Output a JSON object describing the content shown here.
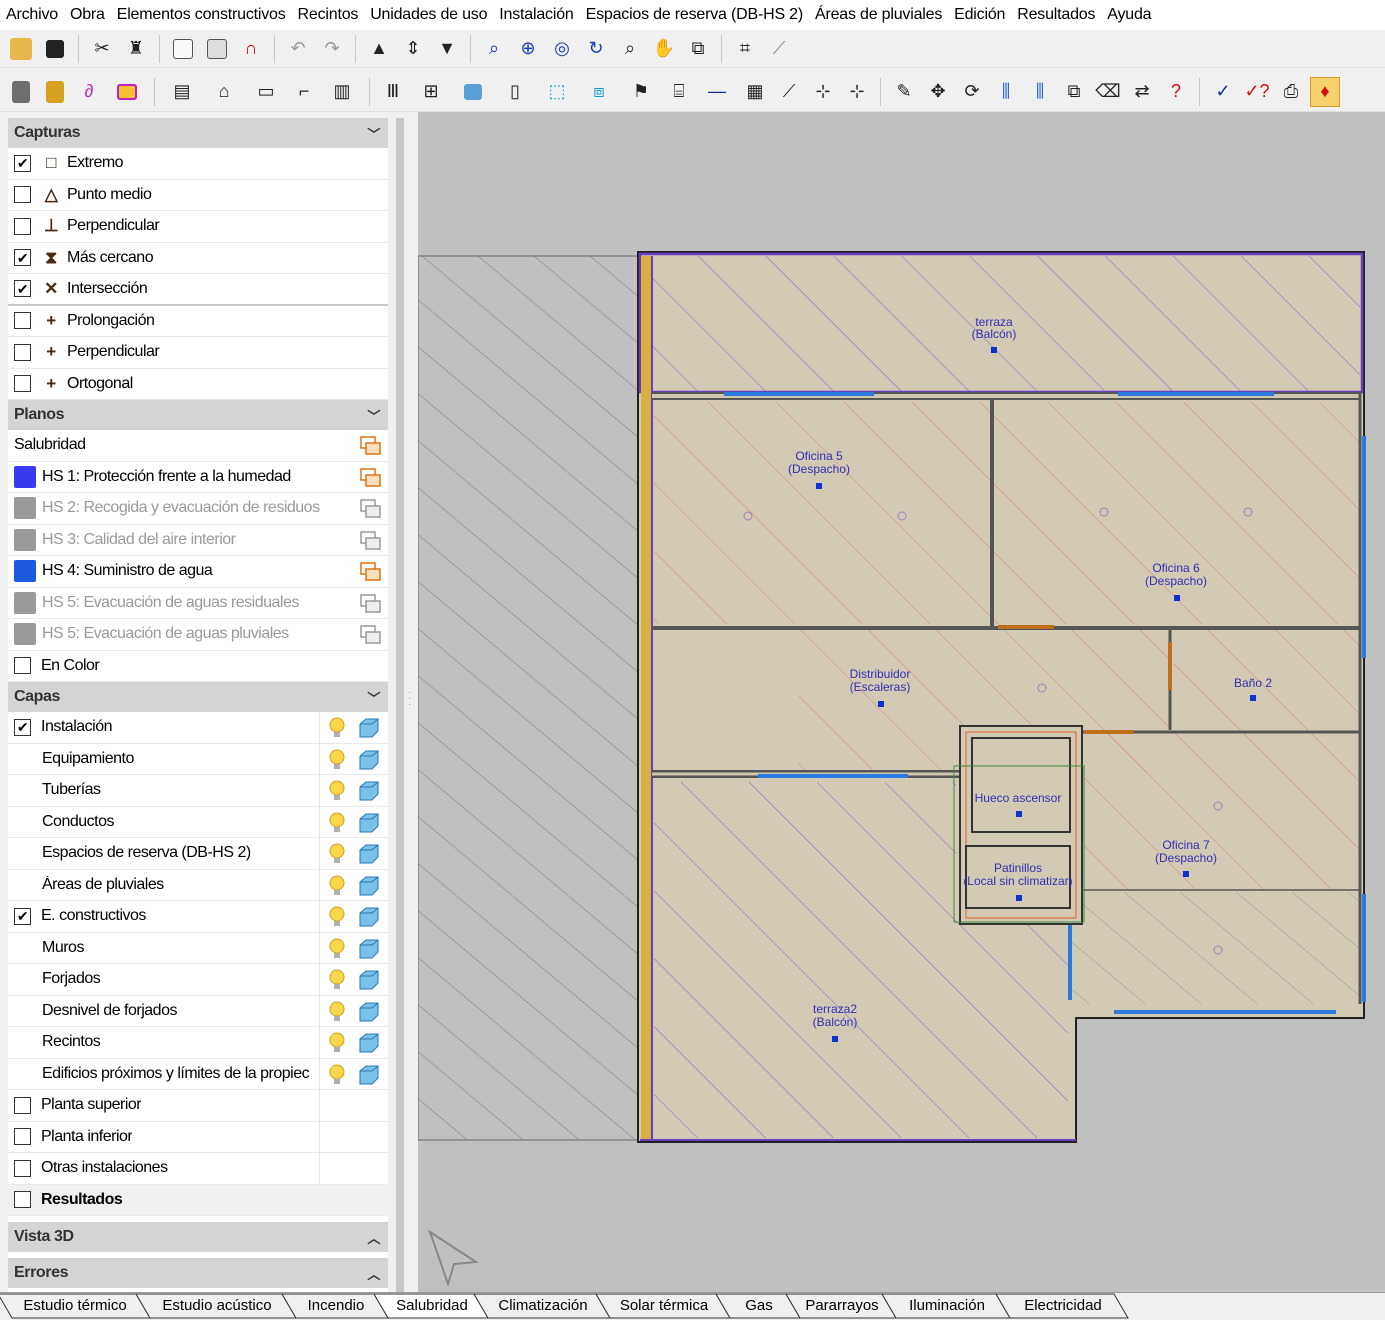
{
  "menu": [
    "Archivo",
    "Obra",
    "Elementos constructivos",
    "Recintos",
    "Unidades de uso",
    "Instalación",
    "Espacios de reserva (DB-HS 2)",
    "Áreas de pluviales",
    "Edición",
    "Resultados",
    "Ayuda"
  ],
  "capturas": {
    "title": "Capturas",
    "items": [
      {
        "label": "Extremo",
        "checked": true,
        "icon": "□"
      },
      {
        "label": "Punto medio",
        "checked": false,
        "icon": "△"
      },
      {
        "label": "Perpendicular",
        "checked": false,
        "icon": "⊥"
      },
      {
        "label": "Más cercano",
        "checked": true,
        "icon": "⧗"
      },
      {
        "label": "Intersección",
        "checked": true,
        "icon": "✕"
      },
      {
        "label": "Prolongación",
        "checked": false,
        "icon": "+"
      },
      {
        "label": "Perpendicular",
        "checked": false,
        "icon": "+"
      },
      {
        "label": "Ortogonal",
        "checked": false,
        "icon": "+"
      }
    ]
  },
  "planos": {
    "title": "Planos",
    "group_label": "Salubridad",
    "items": [
      {
        "label": "HS 1: Protección frente a la humedad",
        "enabled": true,
        "color": "#3a3af0"
      },
      {
        "label": "HS 2: Recogida y evacuación de residuos",
        "enabled": false,
        "color": "#9a9a9a"
      },
      {
        "label": "HS 3: Calidad del aire interior",
        "enabled": false,
        "color": "#9a9a9a"
      },
      {
        "label": "HS 4: Suministro de agua",
        "enabled": true,
        "color": "#1a5adc"
      },
      {
        "label": "HS 5: Evacuación de aguas residuales",
        "enabled": false,
        "color": "#9a9a9a"
      },
      {
        "label": "HS 5: Evacuación de aguas pluviales",
        "enabled": false,
        "color": "#9a9a9a"
      }
    ],
    "color_label": "En Color"
  },
  "capas": {
    "title": "Capas",
    "items": [
      {
        "label": "Instalación",
        "checkbox": true,
        "checked": true,
        "icons": true
      },
      {
        "label": "Equipamiento",
        "checkbox": false,
        "icons": true
      },
      {
        "label": "Tuberías",
        "checkbox": false,
        "icons": true
      },
      {
        "label": "Conductos",
        "checkbox": false,
        "icons": true
      },
      {
        "label": "Espacios de reserva (DB-HS 2)",
        "checkbox": false,
        "icons": true
      },
      {
        "label": "Áreas de pluviales",
        "checkbox": false,
        "icons": true
      },
      {
        "label": "E. constructivos",
        "checkbox": true,
        "checked": true,
        "icons": true
      },
      {
        "label": "Muros",
        "checkbox": false,
        "icons": true
      },
      {
        "label": "Forjados",
        "checkbox": false,
        "icons": true
      },
      {
        "label": "Desnivel de forjados",
        "checkbox": false,
        "icons": true
      },
      {
        "label": "Recintos",
        "checkbox": false,
        "icons": true
      },
      {
        "label": "Edificios próximos y límites de la propiec",
        "checkbox": false,
        "icons": true
      },
      {
        "label": "Planta superior",
        "checkbox": true,
        "checked": false,
        "icons": false
      },
      {
        "label": "Planta inferior",
        "checkbox": true,
        "checked": false,
        "icons": false
      },
      {
        "label": "Otras instalaciones",
        "checkbox": true,
        "checked": false,
        "icons": false
      }
    ],
    "results_label": "Resultados"
  },
  "vista3d": {
    "title": "Vista 3D"
  },
  "errores": {
    "title": "Errores"
  },
  "rooms": [
    {
      "name": "terraza",
      "sub": "(Balcón)"
    },
    {
      "name": "Oficina 5",
      "sub": "(Despacho)"
    },
    {
      "name": "Oficina 6",
      "sub": "(Despacho)"
    },
    {
      "name": "Distribuidor",
      "sub": "(Escaleras)"
    },
    {
      "name": "Baño 2",
      "sub": ""
    },
    {
      "name": "Hueco ascensor",
      "sub": ""
    },
    {
      "name": "Patinillos",
      "sub": "(Local sin climatizar)"
    },
    {
      "name": "Oficina 7",
      "sub": "(Despacho)"
    },
    {
      "name": "terraza2",
      "sub": "(Balcón)"
    }
  ],
  "tabs": [
    "Estudio térmico",
    "Estudio acústico",
    "Incendio",
    "Salubridad",
    "Climatización",
    "Solar térmica",
    "Gas",
    "Pararrayos",
    "Iluminación",
    "Electricidad"
  ],
  "active_tab": "Salubridad"
}
